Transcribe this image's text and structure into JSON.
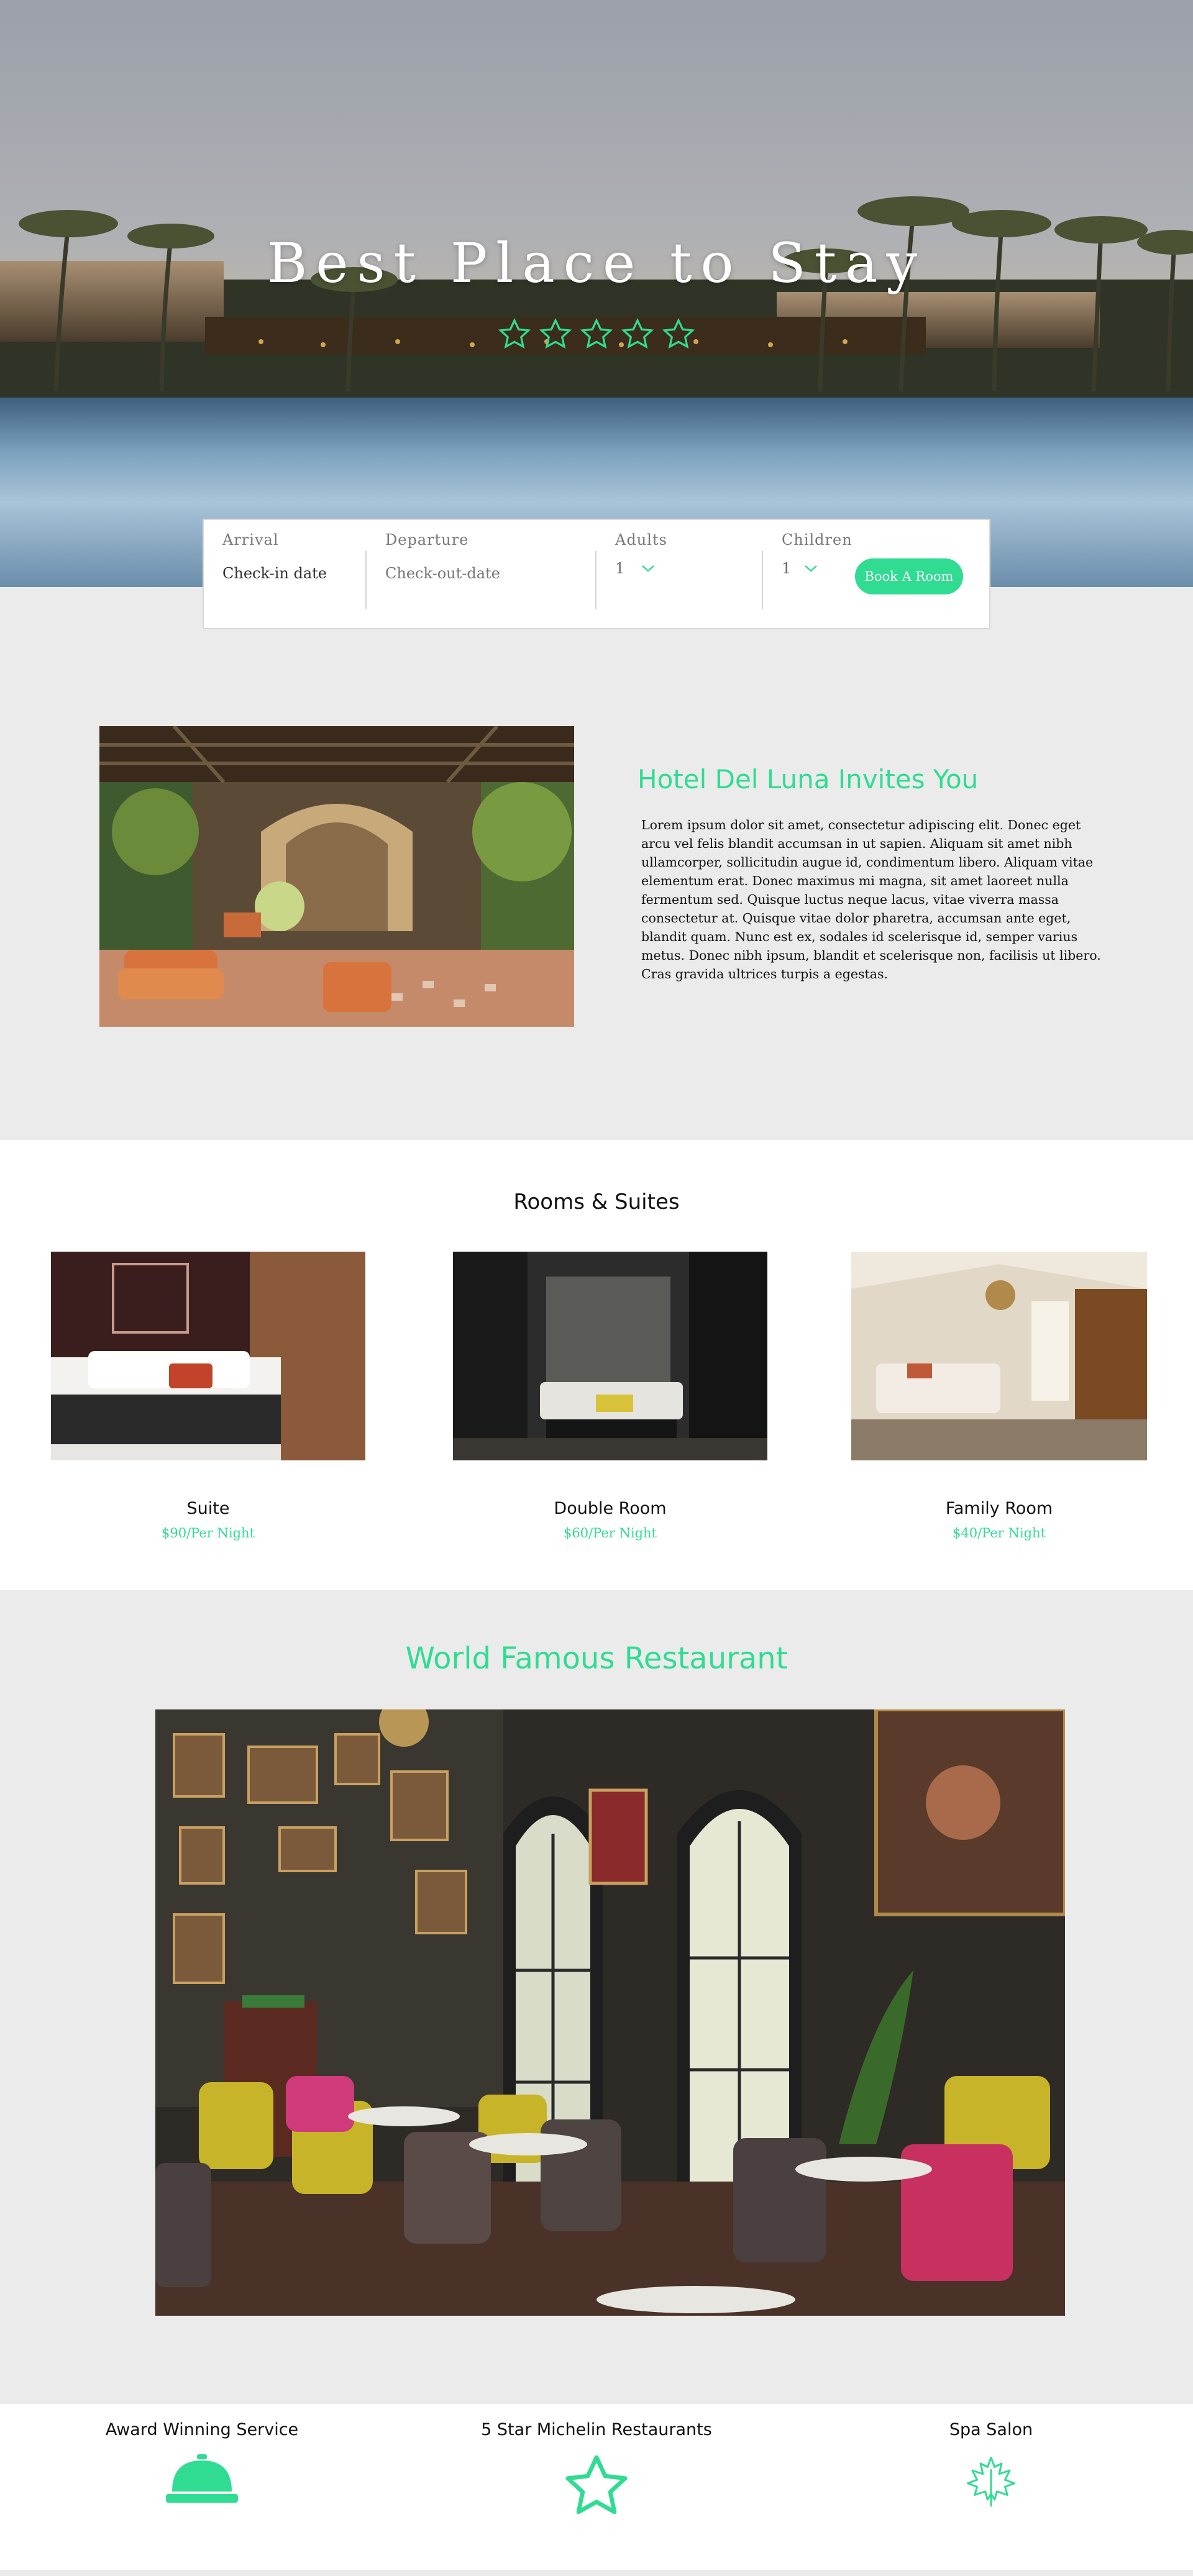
{
  "hero": {
    "title": "Best Place to Stay",
    "star_count": 5,
    "star_color": "#2fdc92"
  },
  "booking": {
    "arrival_label": "Arrival",
    "arrival_placeholder": "Check-in date",
    "departure_label": "Departure",
    "departure_placeholder": "Check-out-date",
    "adults_label": "Adults",
    "adults_value": "1",
    "children_label": "Children",
    "children_value": "1",
    "book_button": "Book A Room"
  },
  "invite": {
    "title": "Hotel Del Luna Invites You",
    "text": "Lorem ipsum dolor sit amet, consectetur adipiscing elit. Donec eget arcu vel felis blandit accumsan in ut sapien. Aliquam sit amet nibh ullamcorper, sollicitudin augue id, condimentum libero. Aliquam vitae elementum erat. Donec maximus mi magna, sit amet laoreet nulla fermentum sed. Quisque luctus neque lacus, vitae viverra massa consectetur at. Quisque vitae dolor pharetra, accumsan ante eget, blandit quam. Nunc est ex, sodales id scelerisque id, semper varius metus. Donec nibh ipsum, blandit et scelerisque non, facilisis ut libero. Cras gravida ultrices turpis a egestas."
  },
  "rooms": {
    "title": "Rooms & Suites",
    "items": [
      {
        "name": "Suite",
        "price": "$90/Per Night"
      },
      {
        "name": "Double Room",
        "price": "$60/Per Night"
      },
      {
        "name": "Family Room",
        "price": "$40/Per Night"
      }
    ]
  },
  "restaurant": {
    "title": "World Famous Restaurant"
  },
  "features": [
    {
      "title": "Award Winning Service",
      "icon": "service-bell-icon"
    },
    {
      "title": "5 Star Michelin Restaurants",
      "icon": "star-outline-icon"
    },
    {
      "title": "Spa Salon",
      "icon": "maple-leaf-icon"
    }
  ],
  "colors": {
    "accent": "#2fdc92",
    "section_gray": "#ebebeb"
  }
}
